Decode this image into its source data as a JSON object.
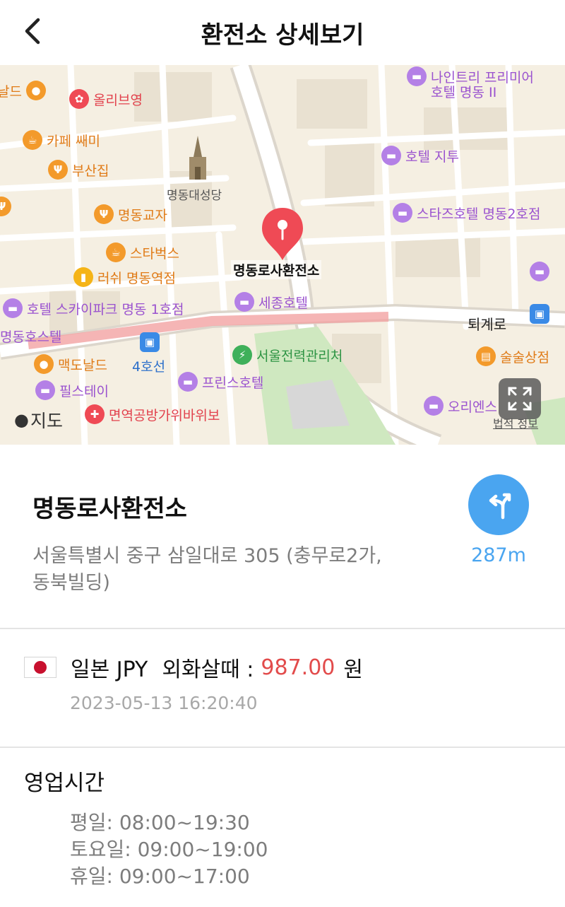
{
  "header": {
    "title": "환전소 상세보기",
    "back_icon": "chevron-left-icon"
  },
  "map": {
    "pin_label": "명동로사환전소",
    "apple_maps_label": "지도",
    "legal_label": "법적 정보",
    "poi": {
      "cafe_ssami": "카페 쌔미",
      "busanjip": "부산집",
      "myeongdong_gyoja": "명동교자",
      "starbucks": "스타벅스",
      "rush": "러쉬 명동역점",
      "olive_young": "올리브영",
      "cathedral": "명동대성당",
      "hotel_skypark": "호텔 스카이파크 명동 1호점",
      "myeongdong_hostel": "명동호스텔",
      "mcdonalds": "맥도날드",
      "pilstay": "필스테이",
      "line4": "4호선",
      "clinic": "면역공방가위바위보",
      "sejong_hotel": "세종호텔",
      "seoul_power": "서울전력관리처",
      "prince_hotel": "프린스호텔",
      "ninetree": "나인트리 프리미어",
      "ninetree2": "호텔 명동 II",
      "hotel_vitu": "호텔 지투",
      "stars_hotel": "스타즈호텔 명동2호점",
      "toegyero": "퇴계로",
      "sulsul": "술술상점",
      "orient": "오리엔스 "
    }
  },
  "exchange": {
    "name": "명동로사환전소",
    "address": "서울특별시 중구 삼일대로 305 (충무로2가, 동북빌딩)",
    "distance": "287m"
  },
  "rate": {
    "country": "일본",
    "code": "JPY",
    "label": "외화살때 :",
    "value": "987.00",
    "unit": "원",
    "timestamp": "2023-05-13 16:20:40",
    "flag_colors": {
      "field": "#ffffff",
      "disc": "#c8102e"
    }
  },
  "hours": {
    "title": "영업시간",
    "weekday": "평일: 08:00~19:30",
    "saturday": "토요일: 09:00~19:00",
    "holiday": "휴일: 09:00~17:00"
  },
  "colors": {
    "accent_blue": "#4aa5f0",
    "rate_red": "#e24b4b",
    "pin_red": "#ef4a55"
  }
}
